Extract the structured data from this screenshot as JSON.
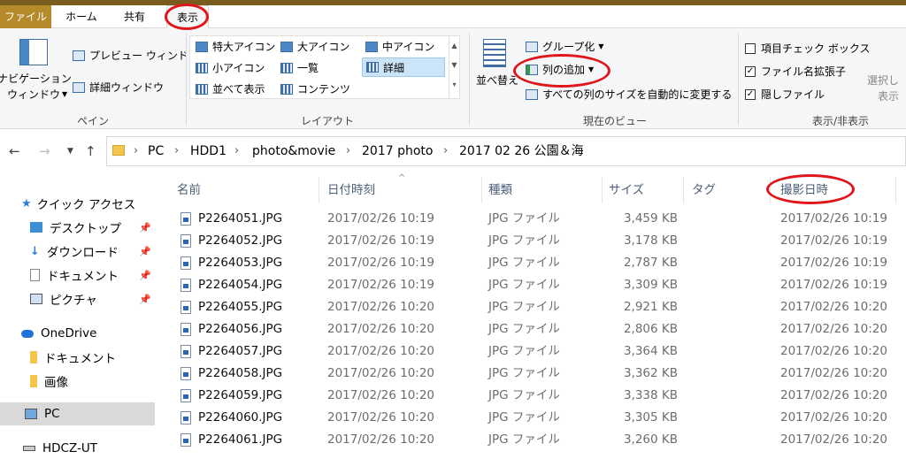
{
  "tabs": {
    "file": "ファイル",
    "home": "ホーム",
    "share": "共有",
    "view": "表示"
  },
  "ribbon": {
    "pane": {
      "nav_pane_line1": "ナビゲーション",
      "nav_pane_line2": "ウィンドウ",
      "preview": "プレビュー ウィンドウ",
      "details": "詳細ウィンドウ",
      "label": "ペイン"
    },
    "layout": {
      "items": [
        "特大アイコン",
        "大アイコン",
        "中アイコン",
        "小アイコン",
        "一覧",
        "詳細",
        "並べて表示",
        "コンテンツ"
      ],
      "label": "レイアウト"
    },
    "current_view": {
      "sort": "並べ替え",
      "group": "グループ化",
      "add_column": "列の追加",
      "autosize": "すべての列のサイズを自動的に変更する",
      "label": "現在のビュー"
    },
    "show_hide": {
      "item_checkbox": "項目チェック ボックス",
      "file_ext": "ファイル名拡張子",
      "hidden": "隠しファイル",
      "selected_partial_1": "選択し",
      "selected_partial_2": "表示",
      "label": "表示/非表示",
      "checks": {
        "item_checkbox": false,
        "file_ext": true,
        "hidden": true
      }
    }
  },
  "address": {
    "crumbs": [
      "PC",
      "HDD1",
      "photo&movie",
      "2017 photo",
      "2017 02 26 公園＆海"
    ]
  },
  "sidebar": {
    "quick_access": "クイック アクセス",
    "items": [
      "デスクトップ",
      "ダウンロード",
      "ドキュメント",
      "ピクチャ"
    ],
    "onedrive": "OneDrive",
    "onedrive_items": [
      "ドキュメント",
      "画像"
    ],
    "pc": "PC",
    "hdcz": "HDCZ-UT"
  },
  "columns": {
    "name": "名前",
    "date": "日付時刻",
    "type": "種類",
    "size": "サイズ",
    "tag": "タグ",
    "taken": "撮影日時"
  },
  "files": [
    {
      "name": "P2264051.JPG",
      "date": "2017/02/26 10:19",
      "type": "JPG ファイル",
      "size": "3,459 KB",
      "taken": "2017/02/26 10:19"
    },
    {
      "name": "P2264052.JPG",
      "date": "2017/02/26 10:19",
      "type": "JPG ファイル",
      "size": "3,178 KB",
      "taken": "2017/02/26 10:19"
    },
    {
      "name": "P2264053.JPG",
      "date": "2017/02/26 10:19",
      "type": "JPG ファイル",
      "size": "2,787 KB",
      "taken": "2017/02/26 10:19"
    },
    {
      "name": "P2264054.JPG",
      "date": "2017/02/26 10:19",
      "type": "JPG ファイル",
      "size": "3,309 KB",
      "taken": "2017/02/26 10:19"
    },
    {
      "name": "P2264055.JPG",
      "date": "2017/02/26 10:20",
      "type": "JPG ファイル",
      "size": "2,921 KB",
      "taken": "2017/02/26 10:20"
    },
    {
      "name": "P2264056.JPG",
      "date": "2017/02/26 10:20",
      "type": "JPG ファイル",
      "size": "2,806 KB",
      "taken": "2017/02/26 10:20"
    },
    {
      "name": "P2264057.JPG",
      "date": "2017/02/26 10:20",
      "type": "JPG ファイル",
      "size": "3,364 KB",
      "taken": "2017/02/26 10:20"
    },
    {
      "name": "P2264058.JPG",
      "date": "2017/02/26 10:20",
      "type": "JPG ファイル",
      "size": "3,362 KB",
      "taken": "2017/02/26 10:20"
    },
    {
      "name": "P2264059.JPG",
      "date": "2017/02/26 10:20",
      "type": "JPG ファイル",
      "size": "3,338 KB",
      "taken": "2017/02/26 10:20"
    },
    {
      "name": "P2264060.JPG",
      "date": "2017/02/26 10:20",
      "type": "JPG ファイル",
      "size": "3,305 KB",
      "taken": "2017/02/26 10:20"
    },
    {
      "name": "P2264061.JPG",
      "date": "2017/02/26 10:20",
      "type": "JPG ファイル",
      "size": "3,260 KB",
      "taken": "2017/02/26 10:20"
    }
  ],
  "colors": {
    "title_bar": "#7a5c1e",
    "file_tab": "#b58a2b",
    "highlight": "#e0161b",
    "selected_nav": "#d9d9d9"
  }
}
